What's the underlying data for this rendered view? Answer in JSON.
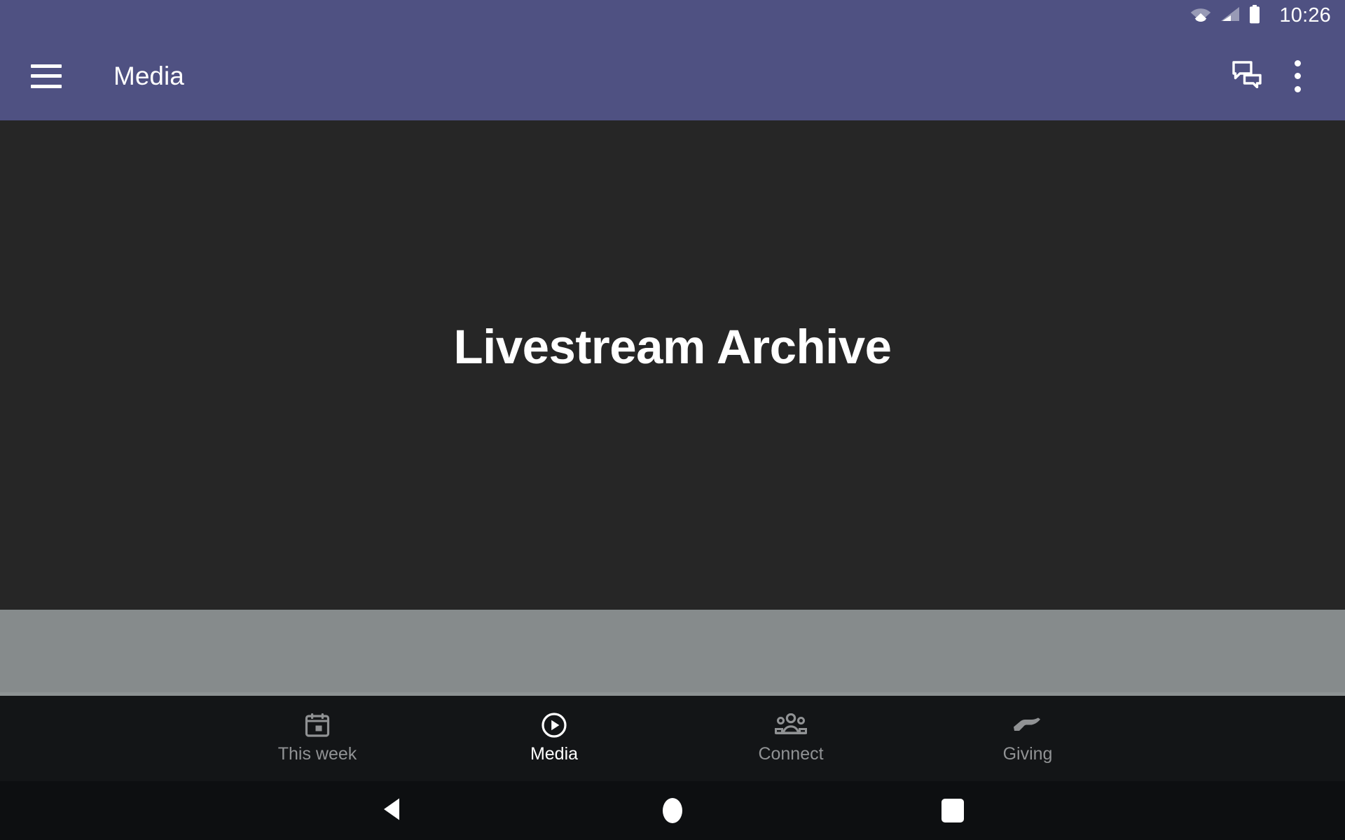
{
  "status_bar": {
    "time": "10:26",
    "icons": [
      "wifi-icon",
      "cellular-signal-icon",
      "battery-icon"
    ],
    "background_color": "#4f5182"
  },
  "app_bar": {
    "menu_icon": "hamburger-menu-icon",
    "title": "Media",
    "actions": [
      {
        "icon": "chat-bubbles-icon",
        "name": "messages"
      },
      {
        "icon": "overflow-menu-icon",
        "name": "more-options"
      }
    ],
    "background_color": "#4f5182"
  },
  "main": {
    "hero_title": "Livestream Archive",
    "background_color": "#262626",
    "band_color": "#868b8c"
  },
  "bottom_nav": {
    "background_color": "#131517",
    "active_color": "#ffffff",
    "inactive_color": "#909294",
    "items": [
      {
        "label": "This week",
        "icon": "calendar-icon",
        "active": false
      },
      {
        "label": "Media",
        "icon": "play-circle-icon",
        "active": true
      },
      {
        "label": "Connect",
        "icon": "people-group-icon",
        "active": false
      },
      {
        "label": "Giving",
        "icon": "giving-hand-icon",
        "active": false
      }
    ]
  },
  "system_nav": {
    "background_color": "#0d0f11",
    "buttons": [
      {
        "name": "back",
        "icon": "back-triangle-icon"
      },
      {
        "name": "home",
        "icon": "home-circle-icon"
      },
      {
        "name": "recents",
        "icon": "recents-square-icon"
      }
    ]
  }
}
